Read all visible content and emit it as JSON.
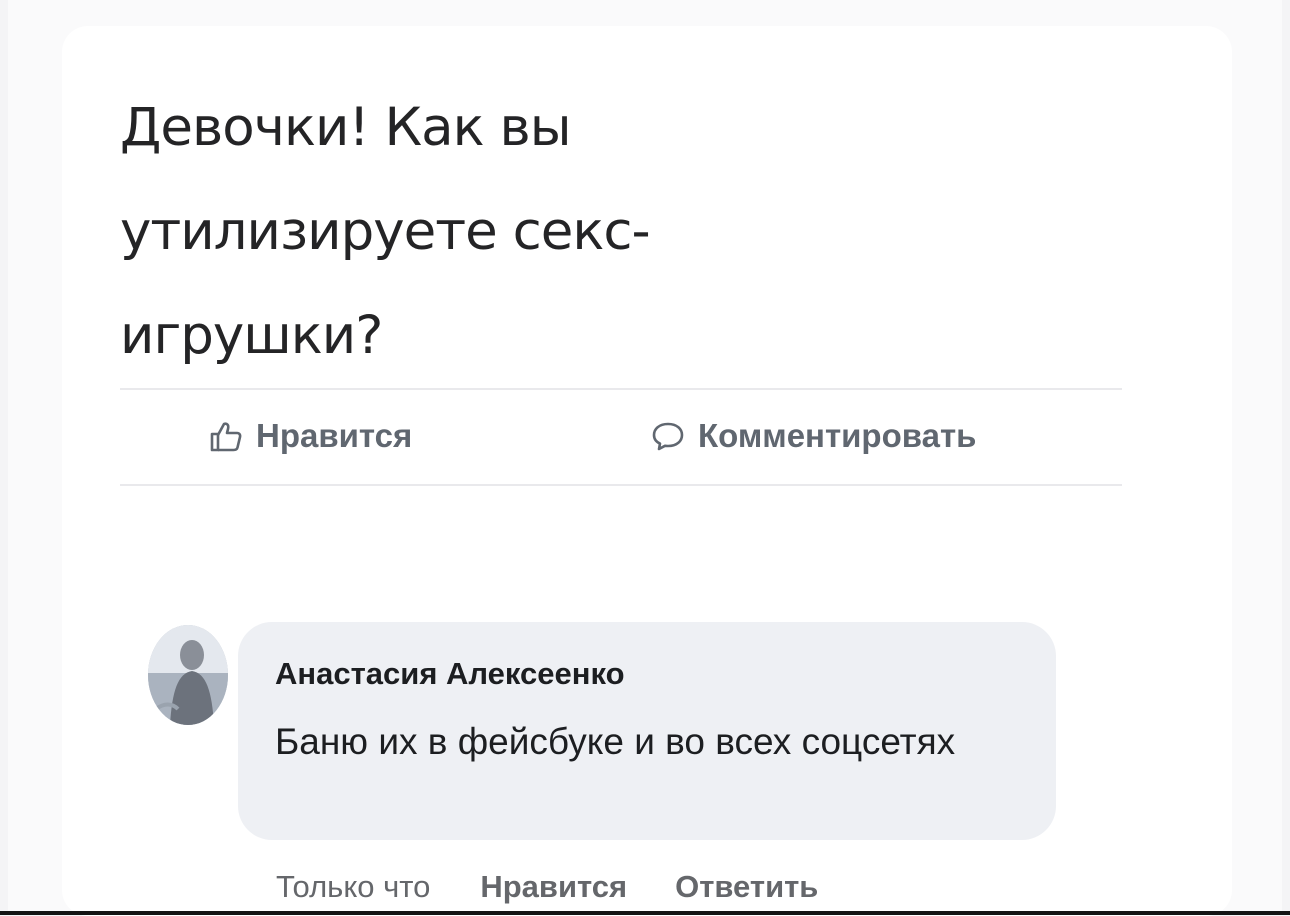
{
  "post": {
    "text": "Девочки! Как вы утилизируете секс-игрушки?"
  },
  "actions": {
    "like_icon": "thumbs-up-icon",
    "like_label": "Нравится",
    "comment_icon": "speech-bubble-icon",
    "comment_label": "Комментировать"
  },
  "comment": {
    "author": "Анастасия Алексеенко",
    "text": "Баню их в фейсбуке и во всех соцсетях",
    "time": "Только что",
    "like_label": "Нравится",
    "reply_label": "Ответить"
  },
  "colors": {
    "action_text": "#606770",
    "bubble_background": "#eef0f4",
    "post_text": "#242426"
  }
}
